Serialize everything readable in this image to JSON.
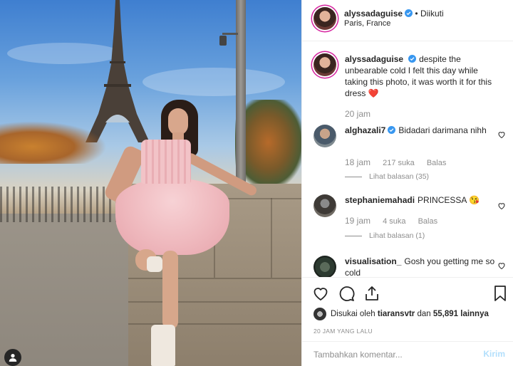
{
  "post": {
    "author": "alyssadaguise",
    "follow_state": "• Diikuti",
    "location": "Paris, France"
  },
  "caption": {
    "username": "alyssadaguise",
    "text": "despite the unbearable cold I felt this day while taking this photo, it was worth it for this dress",
    "emoji": "❤️",
    "time": "20 jam"
  },
  "comments": [
    {
      "username": "alghazali7",
      "text": "Bidadari darimana nihh",
      "time": "18 jam",
      "likes": "217 suka",
      "reply": "Balas",
      "view_replies": "Lihat balasan (35)"
    },
    {
      "username": "stephaniemahadi",
      "text": "PRINCESSA",
      "emoji": "😘",
      "time": "19 jam",
      "likes": "4 suka",
      "reply": "Balas",
      "view_replies": "Lihat balasan (1)"
    },
    {
      "username": "visualisation_",
      "text": "Gosh you getting me so cold"
    }
  ],
  "actions": {
    "liked_by_prefix": "Disukai oleh",
    "liked_by_user": "tiaransvtr",
    "liked_by_and": "dan",
    "liked_by_count": "55,891 lainnya",
    "post_time": "20 JAM YANG LALU"
  },
  "comment_box": {
    "placeholder": "Tambahkan komentar...",
    "send_label": "Kirim"
  },
  "colors": {
    "verified": "#3897f0",
    "heart_red": "#ed4956",
    "send_disabled": "#b2dffc"
  },
  "icons": [
    "verified-icon",
    "more-icon",
    "heart-icon",
    "comment-icon",
    "share-icon",
    "bookmark-icon",
    "user-tag-icon"
  ]
}
